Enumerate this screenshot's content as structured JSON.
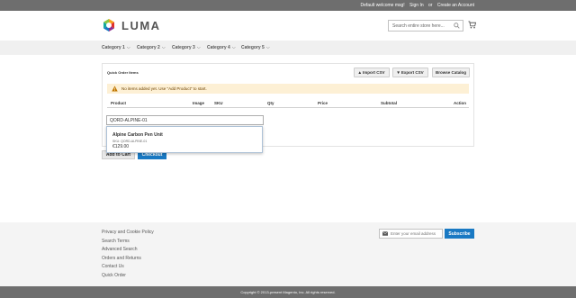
{
  "topbar": {
    "welcome": "Default welcome msg!",
    "sign_in": "Sign In",
    "or": "or",
    "create_account": "Create an Account"
  },
  "header": {
    "brand": "LUMA",
    "search_placeholder": "Search entire store here...",
    "icons": [
      "luma-logo-icon",
      "search-icon",
      "cart-icon"
    ]
  },
  "nav": {
    "items": [
      {
        "label": "Category 1"
      },
      {
        "label": "Category 2"
      },
      {
        "label": "Category 3"
      },
      {
        "label": "Category 4"
      },
      {
        "label": "Category 5"
      }
    ],
    "chevron": "⌵"
  },
  "quick_order": {
    "title": "Quick Order Items",
    "import_label": "Import CSV",
    "export_label": "Export CSV",
    "browse_label": "Browse Catalog",
    "notice": "No items added yet. Use \"Add Product\" to start.",
    "columns": [
      "Product",
      "Image",
      "SKU",
      "Qty",
      "Price",
      "Subtotal",
      "Action"
    ],
    "sku_input_value": "QORD-ALPINE-01",
    "suggestion": {
      "name": "Alpine Carbon Pen Unit",
      "sku": "SKU: QORD-ALPINE-01",
      "price": "€129.00"
    },
    "add_to_cart_label": "Add to Cart",
    "checkout_label": "Checkout"
  },
  "footer": {
    "links": [
      "Privacy and Cookie Policy",
      "Search Terms",
      "Advanced Search",
      "Orders and Returns",
      "Contact Us",
      "Quick Order"
    ],
    "newsletter_placeholder": "Enter your email address",
    "subscribe_label": "Subscribe",
    "copyright": "Copyright © 2013-present Magento, Inc. All rights reserved."
  },
  "colors": {
    "topbar": "#6e6e6e",
    "primary_button": "#1979c3",
    "notice_bg": "#fdf0d5",
    "warning_icon": "#c07600"
  }
}
